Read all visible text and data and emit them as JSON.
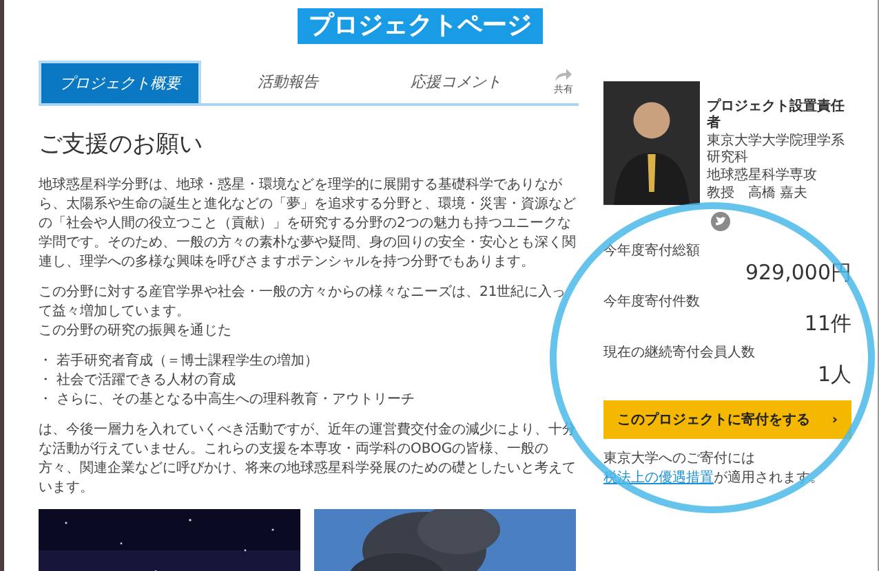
{
  "page_label": "プロジェクトページ",
  "tabs": [
    {
      "label": "プロジェクト概要",
      "selected": true
    },
    {
      "label": "活動報告",
      "selected": false
    },
    {
      "label": "応援コメント",
      "selected": false
    }
  ],
  "share": {
    "label": "共有"
  },
  "heading": "ご支援のお願い",
  "paragraphs": [
    "地球惑星科学分野は、地球・惑星・環境などを理学的に展開する基礎科学でありながら、太陽系や生命の誕生と進化などの「夢」を追求する分野と、環境・災害・資源などの「社会や人間の役立つこと（貢献）」を研究する分野の2つの魅力も持つユニークな学問です。そのため、一般の方々の素朴な夢や疑問、身の回りの安全・安心とも深く関連し、理学への多様な興味を呼びさますポテンシャルを持つ分野でもあります。",
    "この分野に対する産官学界や社会・一般の方々からの様々なニーズは、21世紀に入って益々増加しています。",
    "この分野の研究の振興を通じた"
  ],
  "bullets": [
    "・ 若手研究者育成（＝博士課程学生の増加）",
    "・ 社会で活躍できる人材の育成",
    "・ さらに、その基となる中高生への理科教育・アウトリーチ"
  ],
  "closing": "は、今後一層力を入れていくべき活動ですが、近年の運営費交付金の減少により、十分な活動が行えていません。これらの支援を本専攻・両学科のOBOGの皆様、一般の方々、関連企業などに呼びかけ、将来の地球惑星科学発展のための礎としたいと考えています。",
  "manager": {
    "title": "プロジェクト設置責任者",
    "affiliation": [
      "東京大学大学院理学系研究科",
      "地球惑星科学専攻",
      "教授　高橋 嘉夫"
    ]
  },
  "stats": [
    {
      "label": "今年度寄付総額",
      "value": "929,000円"
    },
    {
      "label": "今年度寄付件数",
      "value": "11件"
    },
    {
      "label": "現在の継続寄付会員人数",
      "value": "1人"
    }
  ],
  "donate_button": {
    "label": "このプロジェクトに寄付をする",
    "arrow": "›"
  },
  "note": {
    "before": "東京大学へのご寄付には",
    "link": "税法上の優遇措置",
    "after": "が適用されます。"
  }
}
